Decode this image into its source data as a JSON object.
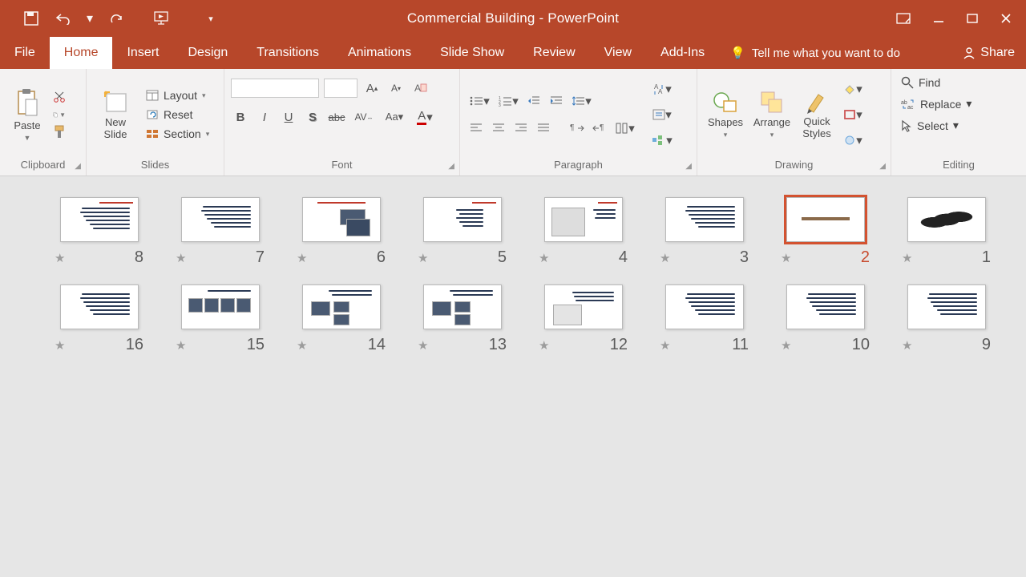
{
  "title": "Commercial Building - PowerPoint",
  "tabs": {
    "file": "File",
    "home": "Home",
    "insert": "Insert",
    "design": "Design",
    "transitions": "Transitions",
    "animations": "Animations",
    "slideshow": "Slide Show",
    "review": "Review",
    "view": "View",
    "addins": "Add-Ins"
  },
  "tell_me": "Tell me what you want to do",
  "share": "Share",
  "ribbon": {
    "clipboard": {
      "label": "Clipboard",
      "paste": "Paste"
    },
    "slides": {
      "label": "Slides",
      "new_slide": "New\nSlide",
      "layout": "Layout",
      "reset": "Reset",
      "section": "Section"
    },
    "font": {
      "label": "Font"
    },
    "paragraph": {
      "label": "Paragraph"
    },
    "drawing": {
      "label": "Drawing",
      "shapes": "Shapes",
      "arrange": "Arrange",
      "quick_styles": "Quick\nStyles"
    },
    "editing": {
      "label": "Editing",
      "find": "Find",
      "replace": "Replace",
      "select": "Select"
    }
  },
  "slides": [
    {
      "n": 1,
      "kind": "calli"
    },
    {
      "n": 2,
      "kind": "title",
      "selected": true
    },
    {
      "n": 3,
      "kind": "text"
    },
    {
      "n": 4,
      "kind": "diagram"
    },
    {
      "n": 5,
      "kind": "bullets"
    },
    {
      "n": 6,
      "kind": "twoimg"
    },
    {
      "n": 7,
      "kind": "text"
    },
    {
      "n": 8,
      "kind": "text_red"
    },
    {
      "n": 9,
      "kind": "text"
    },
    {
      "n": 10,
      "kind": "text"
    },
    {
      "n": 11,
      "kind": "text"
    },
    {
      "n": 12,
      "kind": "objimg"
    },
    {
      "n": 13,
      "kind": "threeimg"
    },
    {
      "n": 14,
      "kind": "threeimg"
    },
    {
      "n": 15,
      "kind": "fourimg"
    },
    {
      "n": 16,
      "kind": "text"
    }
  ]
}
